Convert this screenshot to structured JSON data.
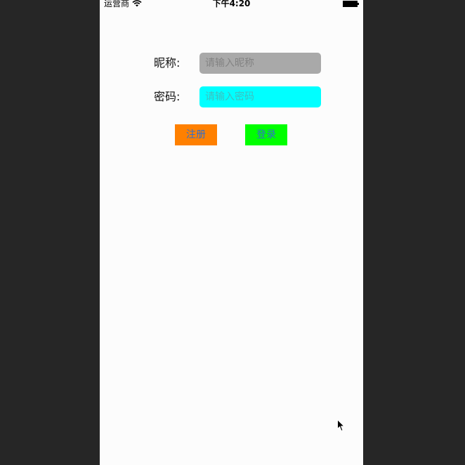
{
  "status_bar": {
    "carrier": "运营商",
    "time": "下午4:20"
  },
  "form": {
    "nickname_label": "昵称:",
    "nickname_placeholder": "请输入昵称",
    "nickname_value": "",
    "password_label": "密码:",
    "password_placeholder": "请输入密码",
    "password_value": ""
  },
  "buttons": {
    "register_label": "注册",
    "login_label": "登录"
  },
  "colors": {
    "nickname_field_bg": "#a9a9a9",
    "password_field_bg": "#00ffff",
    "register_button_bg": "#ff8000",
    "login_button_bg": "#00ff00",
    "button_text": "#2e6fcf"
  },
  "icons": {
    "wifi": "wifi-icon",
    "battery": "battery-icon",
    "cursor": "mouse-cursor-icon"
  }
}
